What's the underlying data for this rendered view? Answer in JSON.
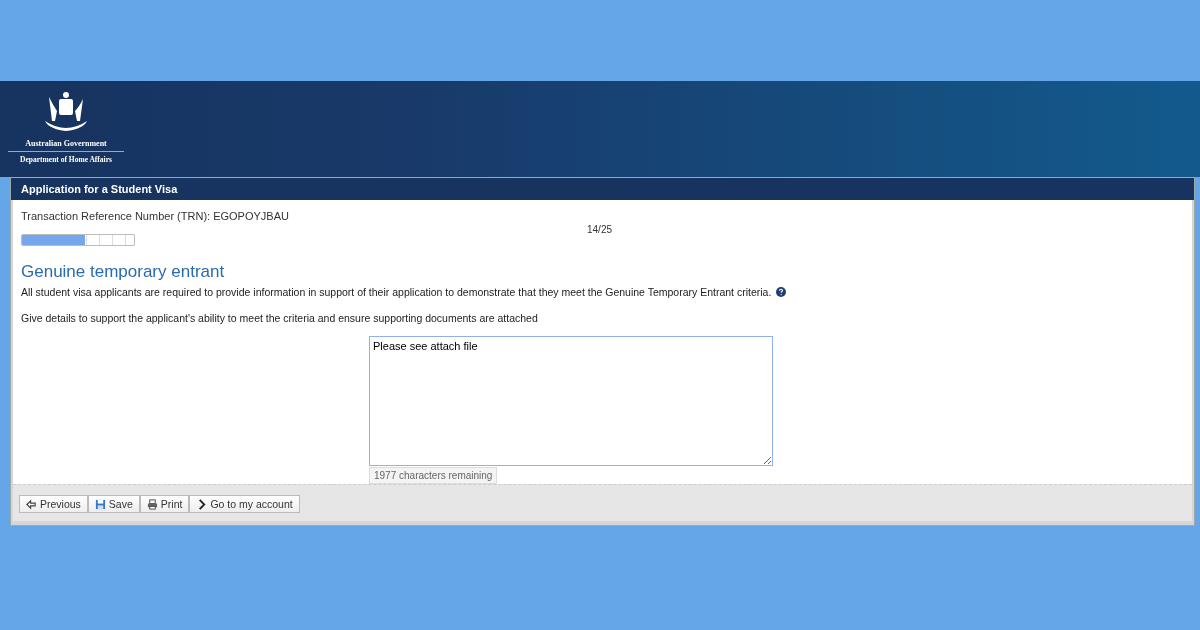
{
  "header": {
    "agency_line_1": "Australian Government",
    "agency_line_2": "Department of Home Affairs"
  },
  "panel": {
    "title": "Application for a Student Visa"
  },
  "trn": "Transaction Reference Number (TRN): EGOPOYJBAU",
  "progress": {
    "level": 0.56,
    "reading": "14/25"
  },
  "section": {
    "heading": "Genuine temporary entrant",
    "intro": "All student visa applicants are required to provide information in support of their application to demonstrate that they meet the Genuine Temporary Entrant criteria.",
    "instruction": "Give details to support the applicant's ability to meet the criteria and ensure supporting documents are attached"
  },
  "answer": {
    "value": "Please see attach file",
    "counter": "1977 characters remaining"
  },
  "buttons": [
    {
      "kind": "previous",
      "label": "Previous"
    },
    {
      "kind": "save",
      "label": "Save"
    },
    {
      "kind": "print",
      "label": "Print"
    },
    {
      "kind": "account",
      "label": "Go to my account"
    }
  ]
}
